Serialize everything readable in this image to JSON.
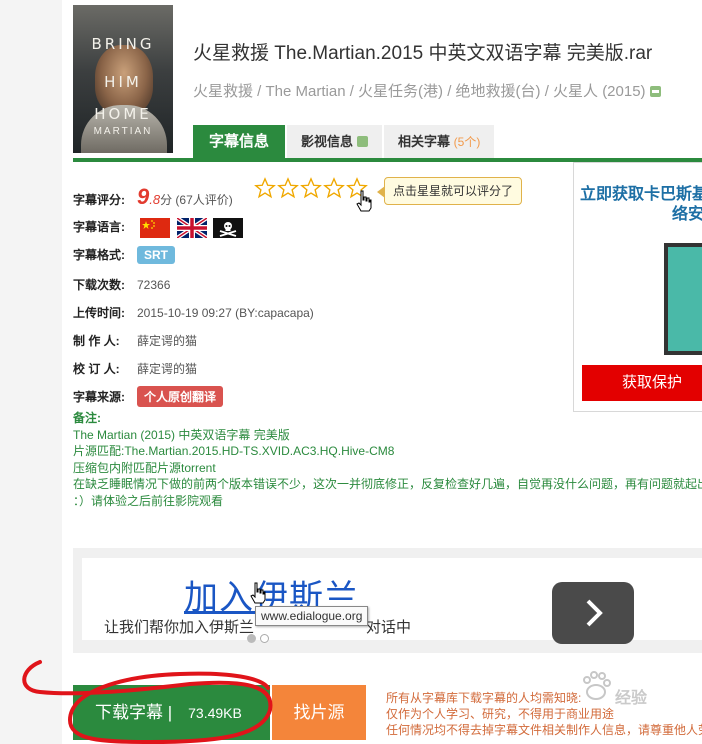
{
  "movie": {
    "poster_lines": [
      "BRING",
      "HIM",
      "HOME"
    ],
    "poster_name": "MARTIAN",
    "title": "火星救援 The.Martian.2015 中英文双语字幕 完美版.rar",
    "aliases": "火星救援 / The Martian / 火星任务(港) / 绝地救援(台) / 火星人 (2015)"
  },
  "tabs": [
    {
      "label": "字幕信息",
      "active": true
    },
    {
      "label": "影视信息",
      "active": false
    },
    {
      "label": "相关字幕",
      "count": "(5个)",
      "active": false
    }
  ],
  "info": {
    "rating_label": "字幕评分:",
    "rating_big": "9",
    "rating_small": ".8",
    "rating_unit": "分 (67人评价)",
    "rate_tip": "点击星星就可以评分了",
    "language_label": "字幕语言:",
    "format_label": "字幕格式:",
    "format": "SRT",
    "downloads_label": "下载次数:",
    "downloads": "72366",
    "upload_label": "上传时间:",
    "upload": "2015-10-19 09:27 (BY:capacapa)",
    "author_label": "制 作 人:",
    "author": "薛定谔的猫",
    "reviewer_label": "校 订 人:",
    "reviewer": "薛定谔的猫",
    "source_label": "字幕来源:",
    "source": "个人原创翻译"
  },
  "notes": {
    "label": "备注:",
    "line1": "The Martian (2015) 中英双语字幕 完美版",
    "line2_label": "片源匹配:",
    "line2": "The.Martian.2015.HD-TS.XVID.AC3.HQ.Hive-CM8",
    "line3": "压缩包内附匹配片源torrent",
    "line4": "在缺乏睡眠情况下做的前两个版本错误不少，这次一并彻底修正，反复检查好几遍，自觉再没什么问题，再有问题就起出去",
    "line5": "：）请体验之后前往影院观看"
  },
  "ad_right": {
    "title_line1": "立即获取卡巴斯基",
    "title_line2": "络安",
    "button": "获取保护"
  },
  "banner": {
    "headline": "加入伊斯兰",
    "subline": "让我们帮你加入伊斯兰",
    "subline_tail": "对话中",
    "url_tooltip": "www.edialogue.org"
  },
  "actions": {
    "download": "下载字幕 |",
    "size": "73.49KB",
    "find_source": "找片源"
  },
  "disclaimer": {
    "line1": "所有从字幕库下载字幕的人均需知晓:",
    "line2": "仅作为个人学习、研究，不得用于商业用途",
    "line3": "任何情况均不得去掉字幕文件相关制作人信息，请尊重他人劳动"
  },
  "watermark": "经验",
  "colors": {
    "green": "#2b8a3e",
    "orange": "#f4853a",
    "red": "#d9534f",
    "blue_badge": "#6fb9dd"
  }
}
